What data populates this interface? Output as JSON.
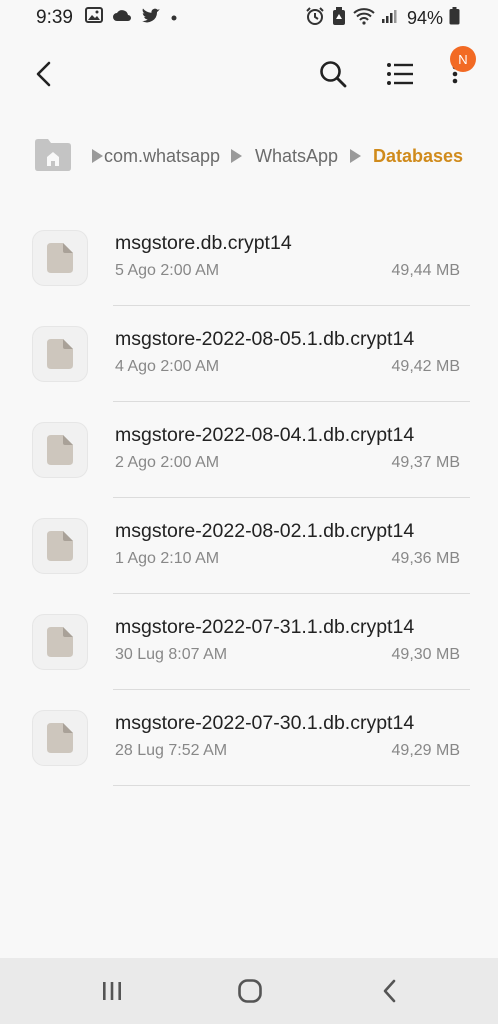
{
  "status_bar": {
    "time": "9:39",
    "battery_pct": "94%"
  },
  "toolbar": {
    "badge": "N"
  },
  "breadcrumb": {
    "items": [
      {
        "label": "com.whatsapp"
      },
      {
        "label": "WhatsApp"
      },
      {
        "label": "Databases"
      }
    ]
  },
  "files": [
    {
      "name": "msgstore.db.crypt14",
      "date": "5 Ago 2:00 AM",
      "size": "49,44 MB"
    },
    {
      "name": "msgstore-2022-08-05.1.db.crypt14",
      "date": "4 Ago 2:00 AM",
      "size": "49,42 MB"
    },
    {
      "name": "msgstore-2022-08-04.1.db.crypt14",
      "date": "2 Ago 2:00 AM",
      "size": "49,37 MB"
    },
    {
      "name": "msgstore-2022-08-02.1.db.crypt14",
      "date": "1 Ago 2:10 AM",
      "size": "49,36 MB"
    },
    {
      "name": "msgstore-2022-07-31.1.db.crypt14",
      "date": "30 Lug 8:07 AM",
      "size": "49,30 MB"
    },
    {
      "name": "msgstore-2022-07-30.1.db.crypt14",
      "date": "28 Lug 7:52 AM",
      "size": "49,29 MB"
    }
  ],
  "colors": {
    "accent": "#d08b1c",
    "badge": "#f26a24",
    "background": "#f8f8f8"
  },
  "icons": [
    "image-icon",
    "cloud-icon",
    "twitter-icon",
    "alarm-icon",
    "recycle-icon",
    "wifi-icon",
    "signal-icon",
    "battery-icon",
    "back-arrow-icon",
    "search-icon",
    "list-view-icon",
    "more-vert-icon",
    "home-folder-icon",
    "file-icon",
    "recent-apps-icon",
    "home-icon",
    "nav-back-icon"
  ]
}
